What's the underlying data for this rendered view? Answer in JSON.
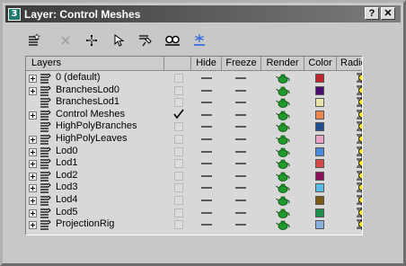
{
  "window": {
    "title": "Layer: Control Meshes",
    "help_label": "?",
    "close_label": "✕"
  },
  "toolbar": {
    "buttons": [
      {
        "name": "create-layer-icon"
      },
      {
        "name": "delete-layer-icon"
      },
      {
        "name": "add-to-layer-icon"
      },
      {
        "name": "select-objects-icon"
      },
      {
        "name": "highlight-layer-icon"
      },
      {
        "name": "hide-all-icon"
      },
      {
        "name": "freeze-all-icon"
      }
    ]
  },
  "columns": {
    "layers": "Layers",
    "hide": "Hide",
    "freeze": "Freeze",
    "render": "Render",
    "color": "Color",
    "radiosity": "Radiosity"
  },
  "layers": [
    {
      "name": "0 (default)",
      "expandable": true,
      "active": false,
      "color": "#c0272d"
    },
    {
      "name": "BranchesLod0",
      "expandable": true,
      "active": false,
      "color": "#4b0e6e"
    },
    {
      "name": "BranchesLod1",
      "expandable": false,
      "active": false,
      "color": "#e8e3a6"
    },
    {
      "name": "Control Meshes",
      "expandable": true,
      "active": true,
      "color": "#e88a4d"
    },
    {
      "name": "HighPolyBranches",
      "expandable": false,
      "active": false,
      "color": "#1f4f8e"
    },
    {
      "name": "HighPolyLeaves",
      "expandable": true,
      "active": false,
      "color": "#e7a4c3"
    },
    {
      "name": "Lod0",
      "expandable": true,
      "active": false,
      "color": "#4a8ad8"
    },
    {
      "name": "Lod1",
      "expandable": true,
      "active": false,
      "color": "#d44a4a"
    },
    {
      "name": "Lod2",
      "expandable": true,
      "active": false,
      "color": "#8a1359"
    },
    {
      "name": "Lod3",
      "expandable": true,
      "active": false,
      "color": "#5bbde6"
    },
    {
      "name": "Lod4",
      "expandable": true,
      "active": false,
      "color": "#7a5a15"
    },
    {
      "name": "Lod5",
      "expandable": true,
      "active": false,
      "color": "#1f8f4f"
    },
    {
      "name": "ProjectionRig",
      "expandable": true,
      "active": false,
      "color": "#8ab0de"
    }
  ]
}
